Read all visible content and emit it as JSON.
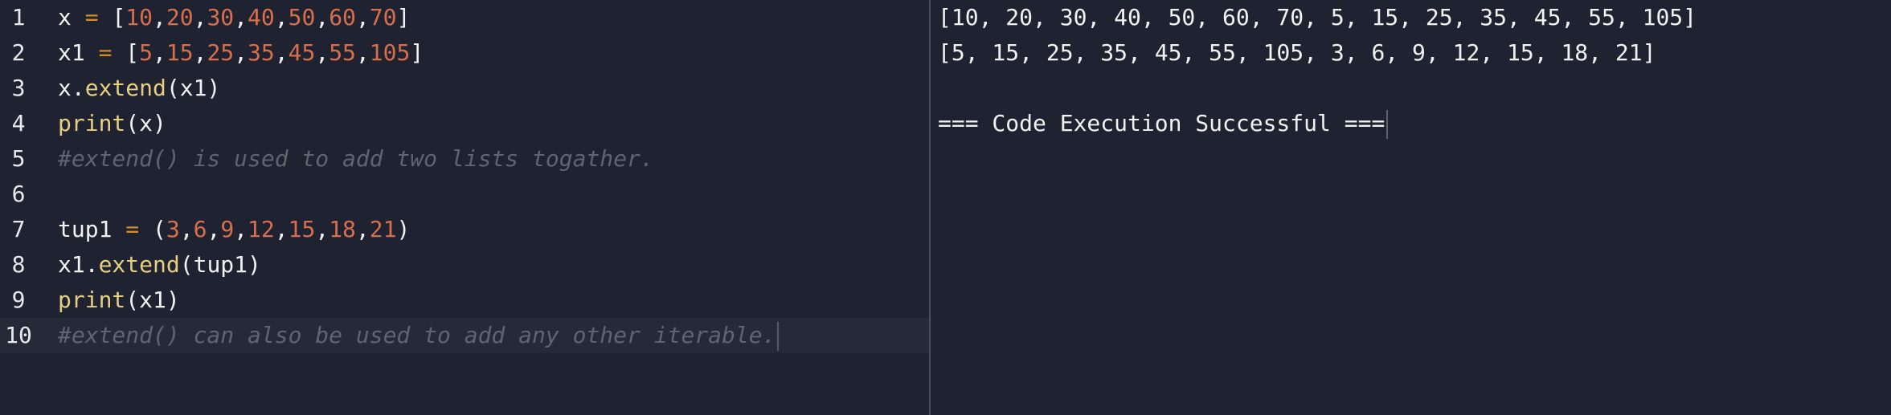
{
  "editor": {
    "lines": [
      {
        "number": "1",
        "tokens": [
          "x",
          " = ",
          "[",
          "10",
          ",",
          "20",
          ",",
          "30",
          ",",
          "40",
          ",",
          "50",
          ",",
          "60",
          ",",
          "70",
          "]"
        ]
      },
      {
        "number": "2",
        "tokens": [
          "x1",
          " = ",
          "[",
          "5",
          ",",
          "15",
          ",",
          "25",
          ",",
          "35",
          ",",
          "45",
          ",",
          "55",
          ",",
          "105",
          "]"
        ]
      },
      {
        "number": "3",
        "tokens": [
          "x",
          ".",
          "extend",
          "(",
          "x1",
          ")"
        ]
      },
      {
        "number": "4",
        "tokens": [
          "print",
          "(",
          "x",
          ")"
        ]
      },
      {
        "number": "5",
        "tokens": [
          "#extend() is used to add two lists togather."
        ]
      },
      {
        "number": "6",
        "tokens": []
      },
      {
        "number": "7",
        "tokens": [
          "tup1",
          " = ",
          "(",
          "3",
          ",",
          "6",
          ",",
          "9",
          ",",
          "12",
          ",",
          "15",
          ",",
          "18",
          ",",
          "21",
          ")"
        ]
      },
      {
        "number": "8",
        "tokens": [
          "x1",
          ".",
          "extend",
          "(",
          "tup1",
          ")"
        ]
      },
      {
        "number": "9",
        "tokens": [
          "print",
          "(",
          "x1",
          ")"
        ]
      },
      {
        "number": "10",
        "tokens": [
          "#extend() can also be used to add any other iterable."
        ]
      }
    ]
  },
  "output": {
    "lines": [
      "[10, 20, 30, 40, 50, 60, 70, 5, 15, 25, 35, 45, 55, 105]",
      "[5, 15, 25, 35, 45, 55, 105, 3, 6, 9, 12, 15, 18, 21]",
      "",
      "=== Code Execution Successful ==="
    ]
  },
  "colors": {
    "background": "#1f2230",
    "active_line": "#262a38",
    "text": "#f2f2f2",
    "number": "#d76f4c",
    "operator": "#d68a2e",
    "function": "#e6cf82",
    "comment": "#60646f",
    "divider": "#4a4e5c"
  }
}
